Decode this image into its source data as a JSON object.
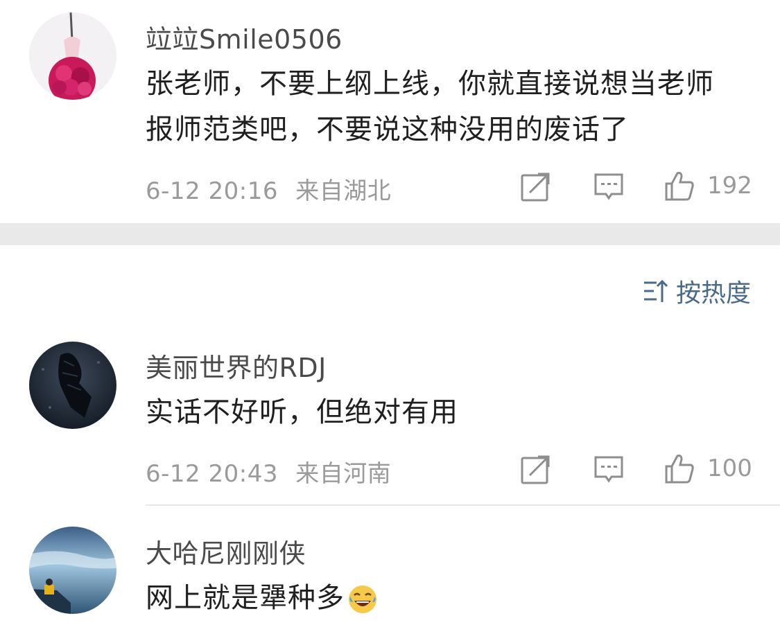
{
  "comments": [
    {
      "name": "竝竝Smile0506",
      "text": "张老师，不要上纲上线，你就直接说想当老师报师范类吧，不要说这种没用的废话了",
      "time": "6-12 20:16",
      "location": "来自湖北",
      "likes": "192"
    },
    {
      "name": "美丽世界的RDJ",
      "text": "实话不好听，但绝对有用",
      "time": "6-12 20:43",
      "location": "来自河南",
      "likes": "100"
    },
    {
      "name": "大哈尼刚刚侠",
      "text": "网上就是犟种多",
      "emoji": "laughing-tears-emoji"
    }
  ],
  "sort": {
    "label": "按热度",
    "icon": "sort-icon"
  },
  "icons": {
    "share": "share-icon",
    "comment": "comment-icon",
    "like": "like-icon"
  },
  "colors": {
    "sort_accent": "#4a6a8a",
    "meta_gray": "#9a9a9a",
    "separator": "#e9e9e9"
  }
}
